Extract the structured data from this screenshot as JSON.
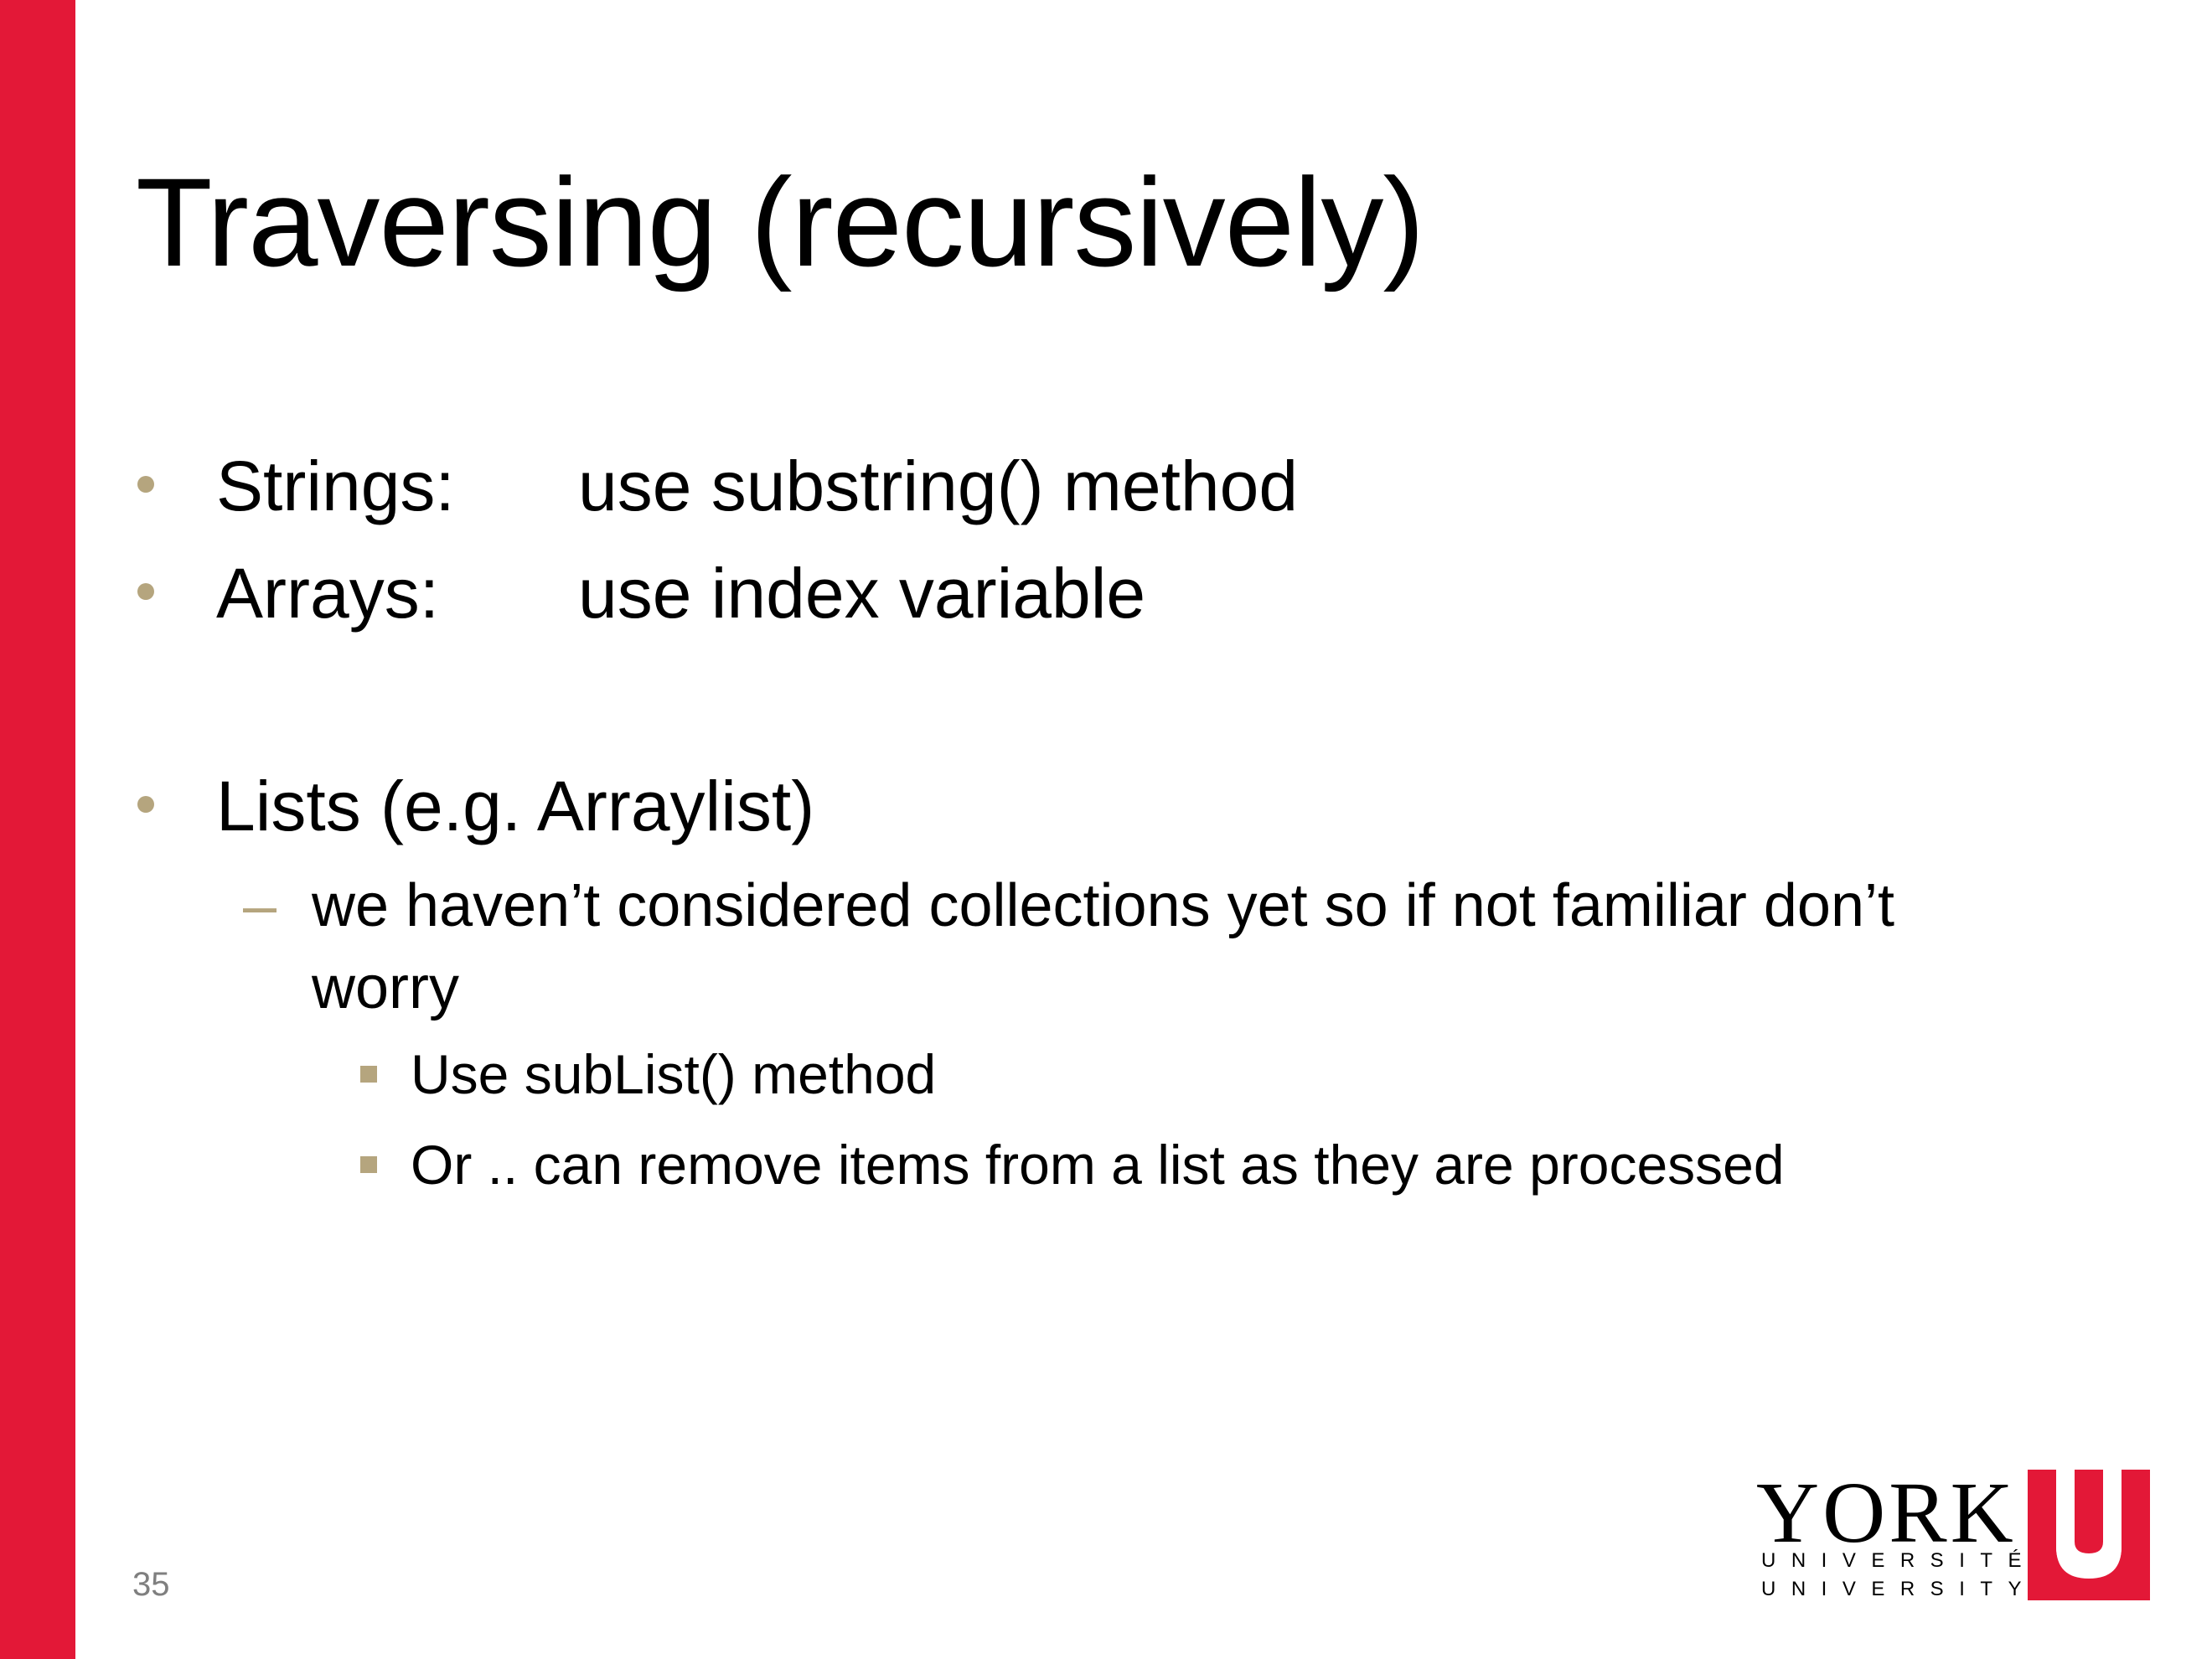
{
  "colors": {
    "accent_red": "#e31837",
    "bullet_tan": "#b5a57e",
    "text": "#000000",
    "page_number": "#7f7f7f",
    "background": "#ffffff"
  },
  "slide": {
    "title": "Traversing (recursively)",
    "bullets": [
      {
        "term": "Strings:",
        "text": "use substring() method"
      },
      {
        "term": "Arrays:",
        "text": "use index variable"
      },
      {
        "term": "Lists (e.g. Arraylist)",
        "sub": {
          "text": "we haven’t considered collections yet so if not familiar don’t worry",
          "items": [
            "Use subList() method",
            "Or .. can remove items from a list as they are processed"
          ]
        }
      }
    ],
    "page_number": "35"
  },
  "logo": {
    "word": "YORK",
    "line_fr": "UNIVERSITÉ",
    "line_en": "UNIVERSITY",
    "mark": "U"
  },
  "icons": {
    "bullet_level1": "round-dot",
    "bullet_level2": "en-dash",
    "bullet_level3": "filled-square"
  }
}
